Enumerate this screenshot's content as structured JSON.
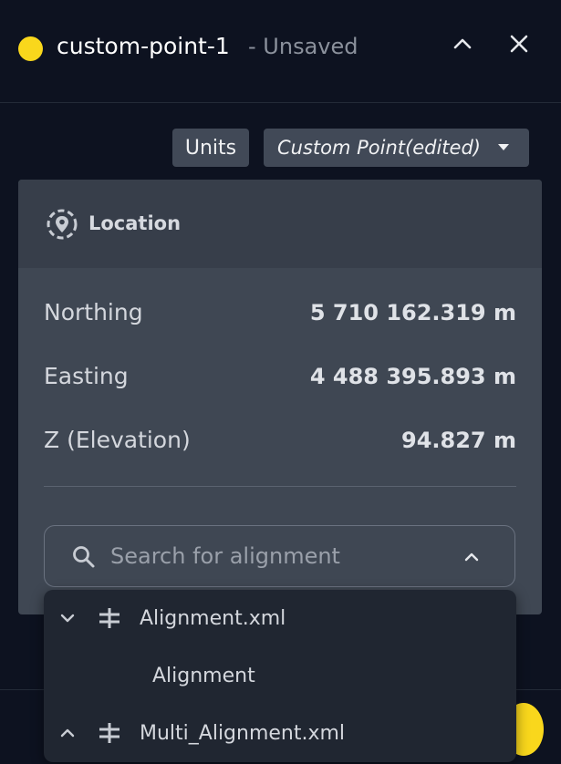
{
  "header": {
    "point_name": "custom-point-1",
    "status": "- Unsaved",
    "dot_color": "#f9d71c"
  },
  "toolbar": {
    "units_label": "Units",
    "preset_label": "Custom Point(edited)"
  },
  "location": {
    "title": "Location",
    "rows": [
      {
        "label": "Northing",
        "value": "5 710 162.319 m"
      },
      {
        "label": "Easting",
        "value": "4 488 395.893 m"
      },
      {
        "label": "Z (Elevation)",
        "value": "94.827 m"
      }
    ]
  },
  "search": {
    "placeholder": "Search for alignment",
    "value": ""
  },
  "dropdown": {
    "items": [
      {
        "label": "Alignment.xml",
        "expanded": true,
        "icon": "alignment-icon"
      },
      {
        "label": "Alignment",
        "child": true
      },
      {
        "label": "Multi_Alignment.xml",
        "expanded": false,
        "icon": "alignment-icon"
      }
    ]
  },
  "colors": {
    "background": "#0d1220",
    "card": "#3f4753",
    "accent": "#f9d71c"
  }
}
